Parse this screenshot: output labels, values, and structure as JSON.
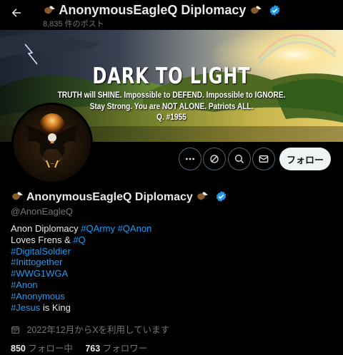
{
  "header": {
    "title": "AnonymousEagleQ Diplomacy",
    "post_count": "8,835 件のポスト"
  },
  "banner": {
    "headline": "DARK TO LIGHT",
    "line1": "TRUTH will SHINE. Impossible to DEFEND. Impossible to IGNORE.",
    "line2": "Stay Strong. You are NOT ALONE. Patriots ALL.",
    "line3": "Q. #1955"
  },
  "actions": {
    "follow_label": "フォロー",
    "icons": [
      "more-icon",
      "grok-icon",
      "search-icon",
      "message-icon"
    ]
  },
  "profile": {
    "name": "AnonymousEagleQ Diplomacy",
    "handle": "@AnonEagleQ",
    "bio": {
      "line1_text": "Anon Diplomacy",
      "line1_tag1": "#QArmy",
      "line1_tag2": "#QAnon",
      "line2_text": "Loves Frens &",
      "line2_tag": "#Q",
      "tag3": "#DigitalSoldier",
      "tag4": "#Inittogether",
      "tag5": "#WWG1WGA",
      "tag6": "#Anon",
      "tag7": "#Anonymous",
      "tag8": "#Jesus",
      "line8_text": "is King"
    },
    "joined": "2022年12月からXを利用しています",
    "following_count": "850",
    "following_label": "フォロー中",
    "followers_count": "763",
    "followers_label": "フォロワー"
  },
  "colors": {
    "accent": "#1d9bf0",
    "background": "#000000",
    "muted": "#71767b"
  }
}
